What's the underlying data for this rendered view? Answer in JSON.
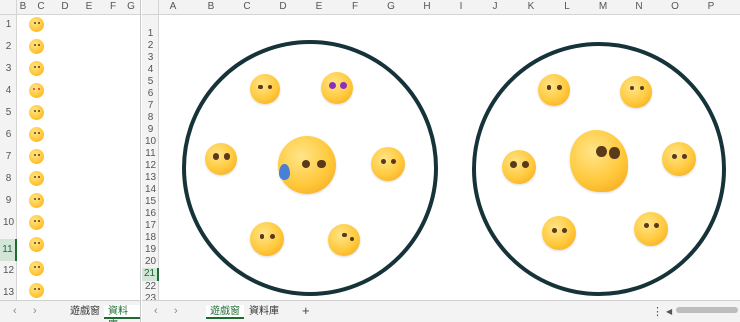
{
  "left": {
    "columns": [
      "B",
      "C",
      "D",
      "E",
      "F",
      "G"
    ],
    "rows": [
      "1",
      "2",
      "3",
      "4",
      "5",
      "6",
      "7",
      "8",
      "9",
      "10",
      "11",
      "12",
      "13"
    ],
    "selected_row": "11",
    "emoji_icons": [
      "winking-tongue-emoji",
      "smiling-emoji",
      "smirk-emoji",
      "heart-eyes-emoji",
      "neutral-emoji",
      "hug-emoji",
      "dizzy-emoji",
      "grin-emoji",
      "sweat-emoji",
      "winking-tongue-emoji",
      "tongue-emoji",
      "eye-roll-emoji",
      "blush-emoji"
    ],
    "tabs": {
      "game": "遊戲窗",
      "data": "資料庫"
    },
    "nav": {
      "prev": "‹",
      "next": "›"
    }
  },
  "right": {
    "columns": [
      "A",
      "B",
      "C",
      "D",
      "E",
      "F",
      "G",
      "H",
      "I",
      "J",
      "K",
      "L",
      "M",
      "N",
      "O",
      "P"
    ],
    "rows": [
      "1",
      "2",
      "3",
      "4",
      "5",
      "6",
      "7",
      "8",
      "9",
      "10",
      "11",
      "12",
      "13",
      "14",
      "15",
      "16",
      "17",
      "18",
      "19",
      "20",
      "21",
      "22",
      "23"
    ],
    "selected_row": "21",
    "tabs": {
      "game": "遊戲窗",
      "data": "資料庫",
      "add": "+"
    },
    "nav": {
      "prev": "‹",
      "next": "›",
      "more": "⋮",
      "scroll_left": "◀"
    },
    "circle_left_emojis": [
      "dizzy-cross-eyes-emoji",
      "star-struck-emoji",
      "spiral-eyes-emoji",
      "sad-sweat-emoji",
      "laughing-blue-emoji",
      "angry-emoji",
      "worried-emoji"
    ],
    "circle_right_emojis": [
      "wink-tongue-emoji",
      "eye-roll-emoji",
      "spiral-eyes-emoji",
      "melting-blob-emoji",
      "crying-emoji",
      "zipper-mouth-emoji",
      "laughing-squint-emoji"
    ]
  },
  "colors": {
    "circle_stroke": "#163339",
    "selected_header": "#1e6b32",
    "emoji_face": "#ffc93c"
  }
}
